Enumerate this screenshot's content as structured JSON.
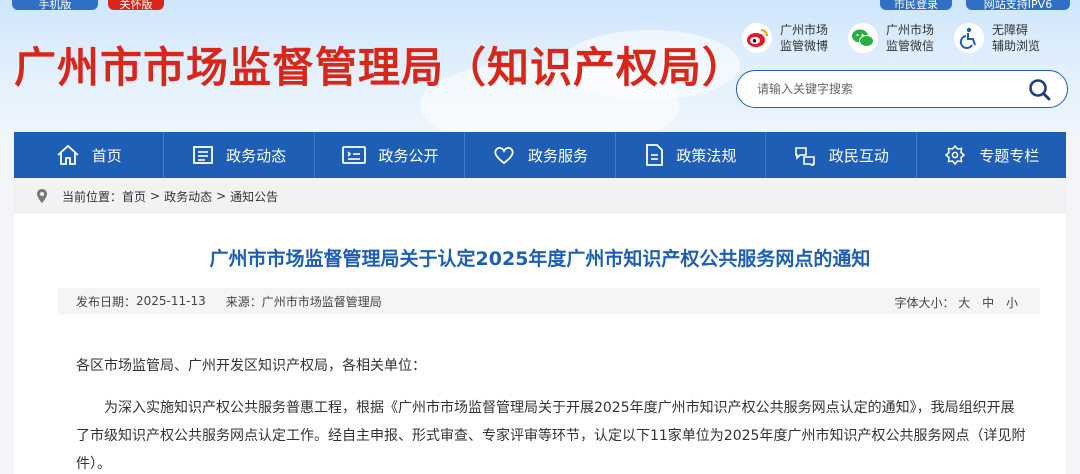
{
  "top_bar": {
    "mobile_label": "手机版",
    "care_label": "关怀版",
    "login_label": "市民登录",
    "ipv6_label": "网站支持IPV6"
  },
  "header": {
    "title": "广州市市场监督管理局（知识产权局）",
    "quick_links": [
      {
        "line1": "广州市场",
        "line2": "监管微博",
        "icon": "weibo-icon"
      },
      {
        "line1": "广州市场",
        "line2": "监管微信",
        "icon": "wechat-icon"
      },
      {
        "line1": "无障碍",
        "line2": "辅助浏览",
        "icon": "accessibility-icon"
      }
    ],
    "search": {
      "placeholder": "请输入关键字搜索"
    }
  },
  "nav": {
    "items": [
      {
        "label": "首页",
        "icon": "home-icon"
      },
      {
        "label": "政务动态",
        "icon": "news-icon"
      },
      {
        "label": "政务公开",
        "icon": "disclosure-icon"
      },
      {
        "label": "政务服务",
        "icon": "heart-icon"
      },
      {
        "label": "政策法规",
        "icon": "document-icon"
      },
      {
        "label": "政民互动",
        "icon": "interaction-icon"
      },
      {
        "label": "专题专栏",
        "icon": "column-icon"
      }
    ]
  },
  "breadcrumb": {
    "prefix": "当前位置：",
    "items": [
      "首页",
      "政务动态",
      "通知公告"
    ],
    "separator": ">"
  },
  "article": {
    "title": "广州市市场监督管理局关于认定2025年度广州市知识产权公共服务网点的通知",
    "meta": {
      "date_label": "发布日期：",
      "date": "2025-11-13",
      "source_label": "来源：",
      "source": "广州市市场监督管理局",
      "font_size_label": "字体大小：",
      "sizes": [
        "大",
        "中",
        "小"
      ]
    },
    "paragraphs": [
      "各区市场监管局、广州开发区知识产权局，各相关单位：",
      "为深入实施知识产权公共服务普惠工程，根据《广州市市场监督管理局关于开展2025年度广州市知识产权公共服务网点认定的通知》，我局组织开展了市级知识产权公共服务网点认定工作。经自主申报、形式审查、专家评审等环节，认定以下11家单位为2025年度广州市知识产权公共服务网点（详见附件）。"
    ]
  },
  "colors": {
    "brand_red": "#d8261a",
    "nav_blue": "#1f5eb5",
    "title_blue": "#1f5eb5"
  }
}
